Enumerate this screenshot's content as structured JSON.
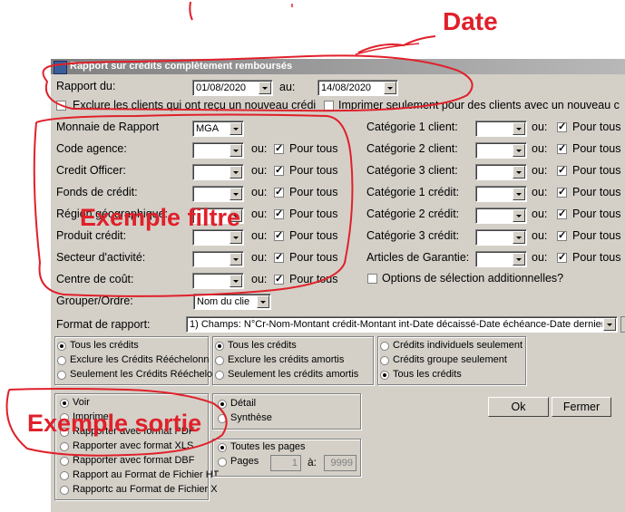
{
  "window": {
    "title": "Rapport sur crédits complètement remboursés"
  },
  "annotations": {
    "date": "Date",
    "filtre": "Exemple filtre",
    "sortie": "Exemple sortie",
    "color": "#e0202a"
  },
  "date_range": {
    "from_label": "Rapport du:",
    "from_value": "01/08/2020",
    "to_label": "au:",
    "to_value": "14/08/2020",
    "exclude_label": "Exclure les clients qui ont reçu un nouveau crédi",
    "print_only_label": "Imprimer seulement pour des clients avec un nouveau c"
  },
  "filters_left": [
    {
      "label": "Monnaie de Rapport",
      "value": "MGA"
    },
    {
      "label": "Code agence:",
      "or": "ou:",
      "all": "Pour tous"
    },
    {
      "label": "Credit Officer:",
      "or": "ou:",
      "all": "Pour tous"
    },
    {
      "label": "Fonds de crédit:",
      "or": "ou:",
      "all": "Pour tous"
    },
    {
      "label": "Région géographique:",
      "or": "ou:",
      "all": "Pour tous"
    },
    {
      "label": "Produit crédit:",
      "or": "ou:",
      "all": "Pour tous"
    },
    {
      "label": "Secteur d'activité:",
      "or": "ou:",
      "all": "Pour tous"
    },
    {
      "label": "Centre de coût:",
      "or": "ou:",
      "all": "Pour tous"
    }
  ],
  "filters_right": [
    {
      "label": "Catégorie 1 client:",
      "or": "ou:",
      "all": "Pour tous"
    },
    {
      "label": "Catégorie 2 client:",
      "or": "ou:",
      "all": "Pour tous"
    },
    {
      "label": "Catégorie 3 client:",
      "or": "ou:",
      "all": "Pour tous"
    },
    {
      "label": "Catégorie 1 crédit:",
      "or": "ou:",
      "all": "Pour tous"
    },
    {
      "label": "Catégorie 2 crédit:",
      "or": "ou:",
      "all": "Pour tous"
    },
    {
      "label": "Catégorie 3 crédit:",
      "or": "ou:",
      "all": "Pour tous"
    },
    {
      "label": "Articles de Garantie:",
      "or": "ou:",
      "all": "Pour tous"
    }
  ],
  "additional_options_label": "Options de sélection additionnelles?",
  "group_order": {
    "label": "Grouper/Ordre:",
    "value": "Nom du clie"
  },
  "report_format": {
    "label": "Format de rapport:",
    "value": "1) Champs: N°Cr-Nom-Montant crédit-Montant int-Date décaissé-Date échéance-Date dernier re"
  },
  "radio_group_1": [
    "Tous les crédits",
    "Exclure les Crédits Rééchelonn",
    "Seulement les Crédits Rééchelo"
  ],
  "radio_group_2": [
    "Tous les crédits",
    "Exclure les crédits amortis",
    "Seulement les crédits amortis"
  ],
  "radio_group_3": [
    "Crédits individuels seulement",
    "Crédits groupe seulement",
    "Tous les crédits"
  ],
  "output_options": [
    "Voir",
    "Imprimer",
    "Rapporter avec format PDF",
    "Rapporter avec format XLS",
    "Rapporter avec format DBF",
    "Rapport au Format de Fichier HT",
    "Rapportc au Format de Fichier X"
  ],
  "detail_options": [
    "Détail",
    "Synthèse"
  ],
  "pages": {
    "all_label": "Toutes les pages",
    "pages_label": "Pages",
    "from": "1",
    "to_label": "à:",
    "to": "9999"
  },
  "buttons": {
    "ok": "Ok",
    "close": "Fermer"
  }
}
